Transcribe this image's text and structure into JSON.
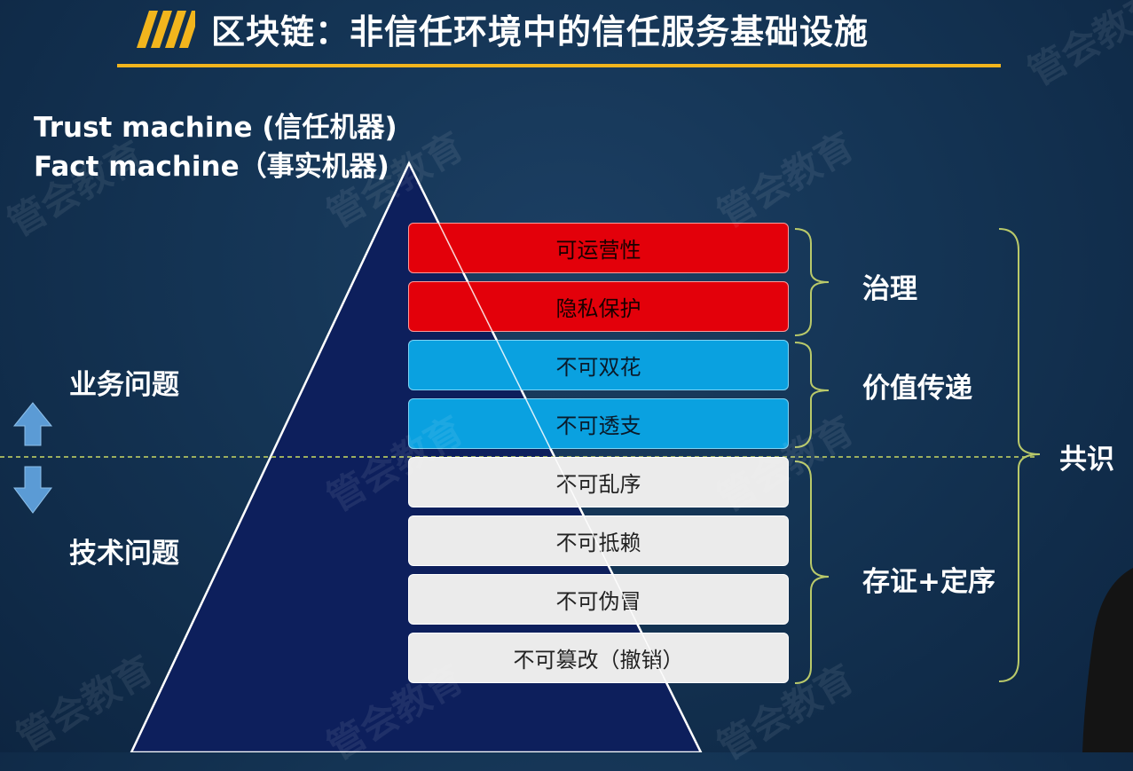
{
  "title": "区块链：非信任环境中的信任服务基础设施",
  "subtitle_lines": [
    "Trust machine (信任机器)",
    "Fact machine（事实机器)"
  ],
  "side_labels": {
    "business": "业务问题",
    "technical": "技术问题"
  },
  "layers": [
    {
      "label": "可运营性",
      "group": "governance"
    },
    {
      "label": "隐私保护",
      "group": "governance"
    },
    {
      "label": "不可双花",
      "group": "value"
    },
    {
      "label": "不可透支",
      "group": "value"
    },
    {
      "label": "不可乱序",
      "group": "evidence"
    },
    {
      "label": "不可抵赖",
      "group": "evidence"
    },
    {
      "label": "不可伪冒",
      "group": "evidence"
    },
    {
      "label": "不可篡改（撤销）",
      "group": "evidence"
    }
  ],
  "groups": {
    "governance": "治理",
    "value": "价值传递",
    "evidence": "存证+定序"
  },
  "consensus": "共识",
  "watermark": "管会教育",
  "colors": {
    "title_accent": "#f2b51d",
    "governance": "#e3000a",
    "value": "#0aa1e0",
    "evidence": "#ebebeb",
    "pyramid": "#0d1f5c",
    "brace": "#b9c96a"
  }
}
